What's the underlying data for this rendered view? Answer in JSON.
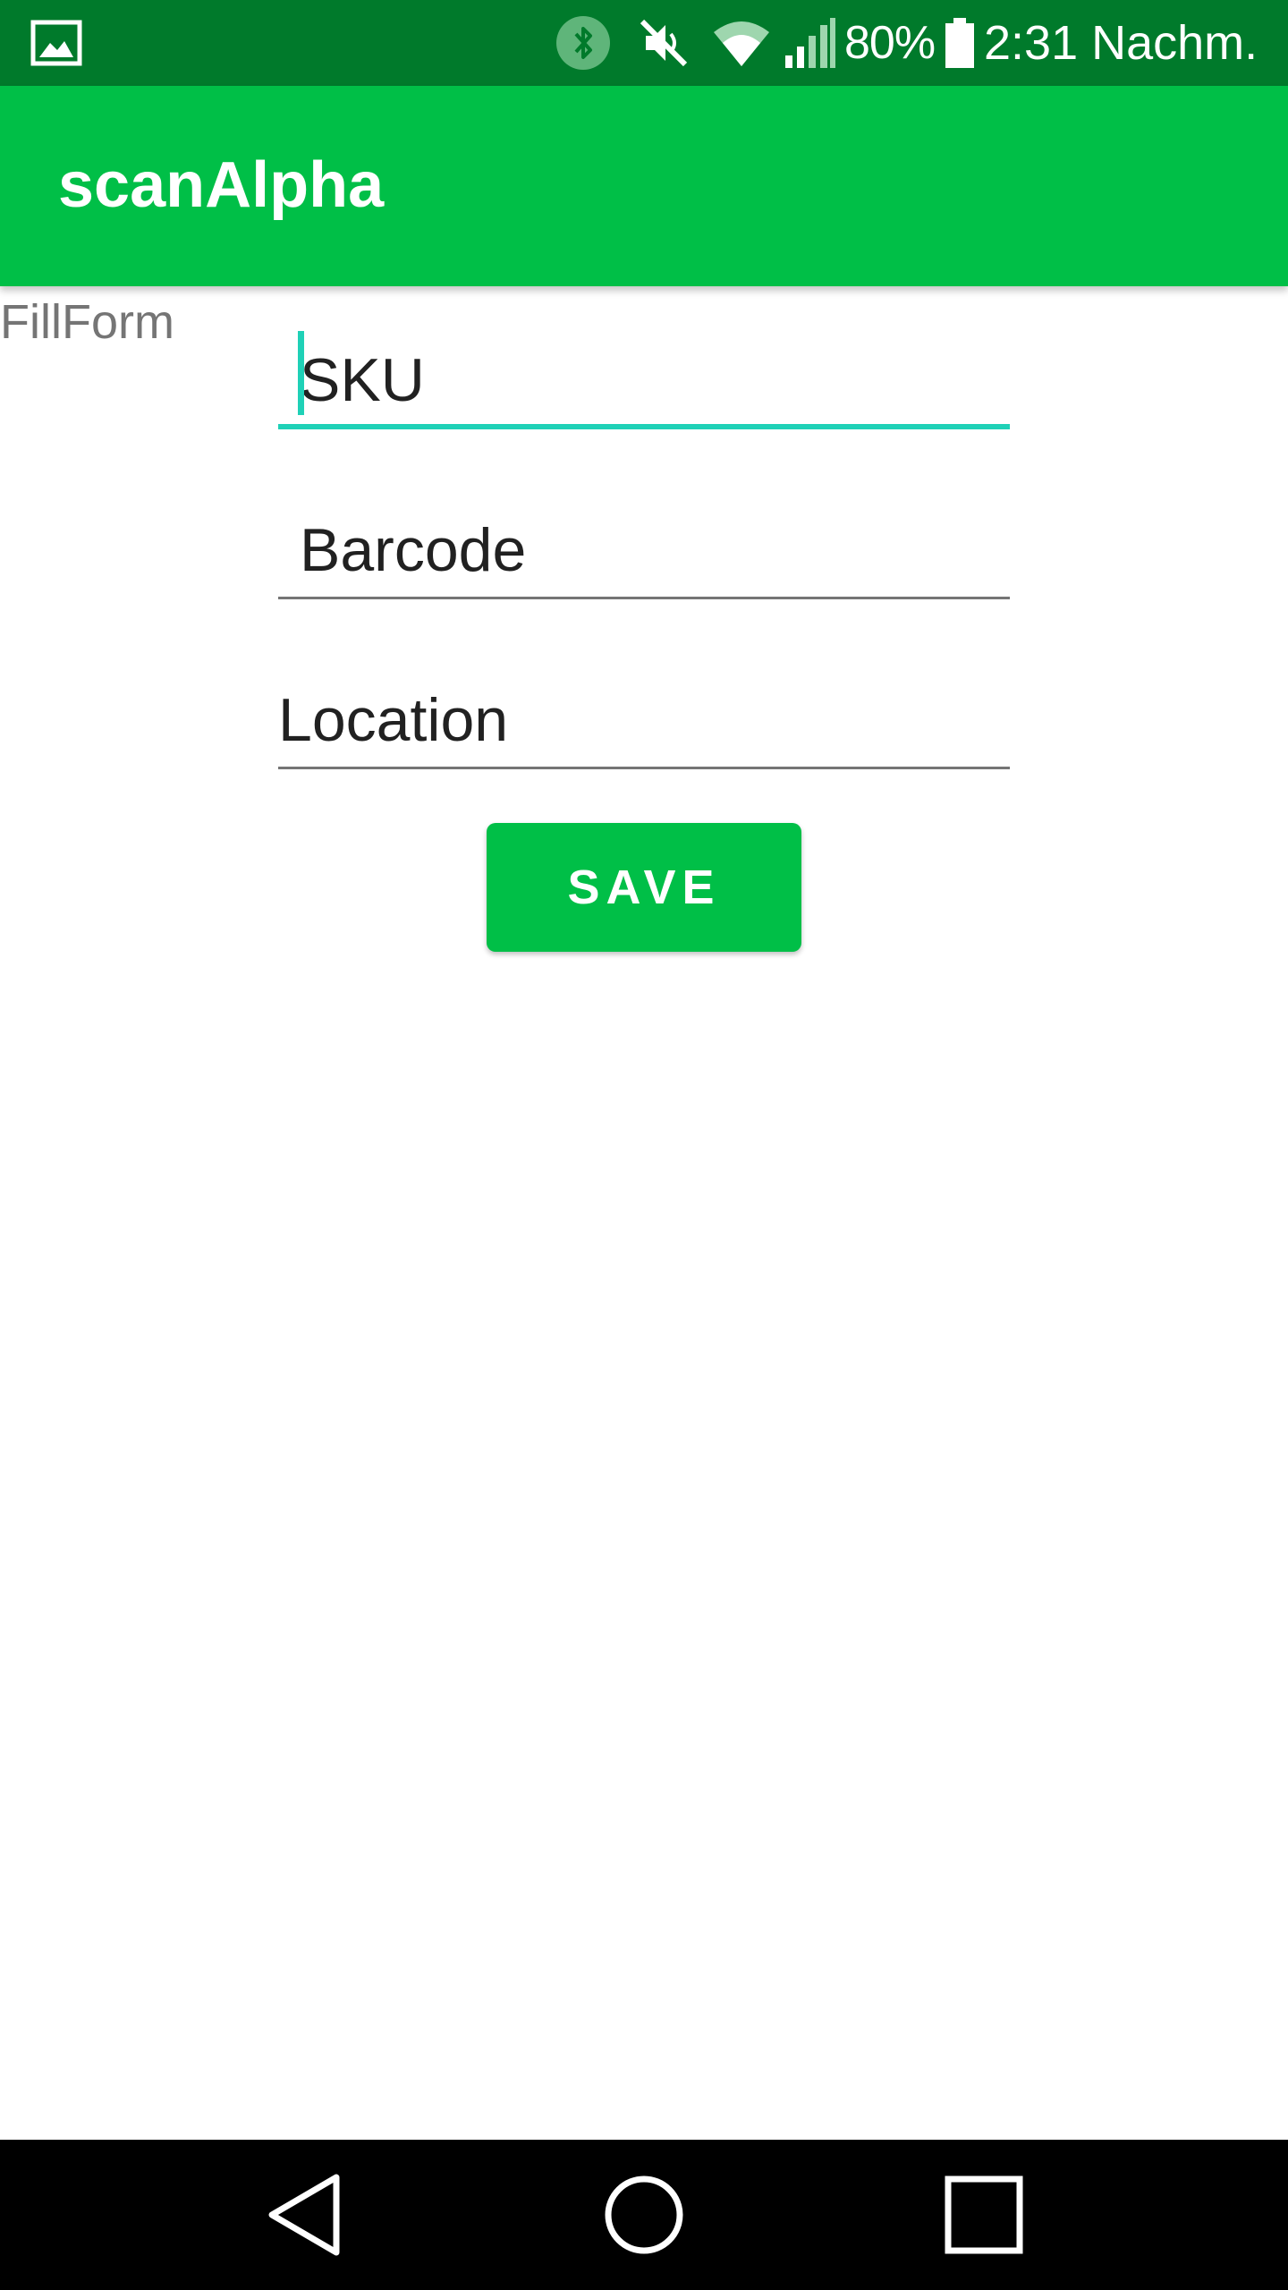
{
  "status_bar": {
    "battery_percent": "80%",
    "time": "2:31 Nachm.",
    "icons": [
      "gallery-icon",
      "bluetooth-icon",
      "mute-icon",
      "wifi-icon",
      "cell-signal-icon",
      "battery-icon"
    ]
  },
  "app_bar": {
    "title": "scanAlpha"
  },
  "form": {
    "label": "FillForm",
    "sku": {
      "placeholder": "SKU",
      "value": ""
    },
    "barcode": {
      "placeholder": "Barcode",
      "value": ""
    },
    "location": {
      "placeholder": "Location",
      "value": ""
    },
    "save_label": "SAVE"
  },
  "nav_bar": {
    "icons": [
      "back-icon",
      "home-icon",
      "recents-icon"
    ]
  },
  "colors": {
    "status_bar": "#007A2B",
    "app_bar": "#00BF47",
    "accent": "#1FD1B7",
    "button": "#00BF47",
    "nav_bar": "#000000"
  }
}
